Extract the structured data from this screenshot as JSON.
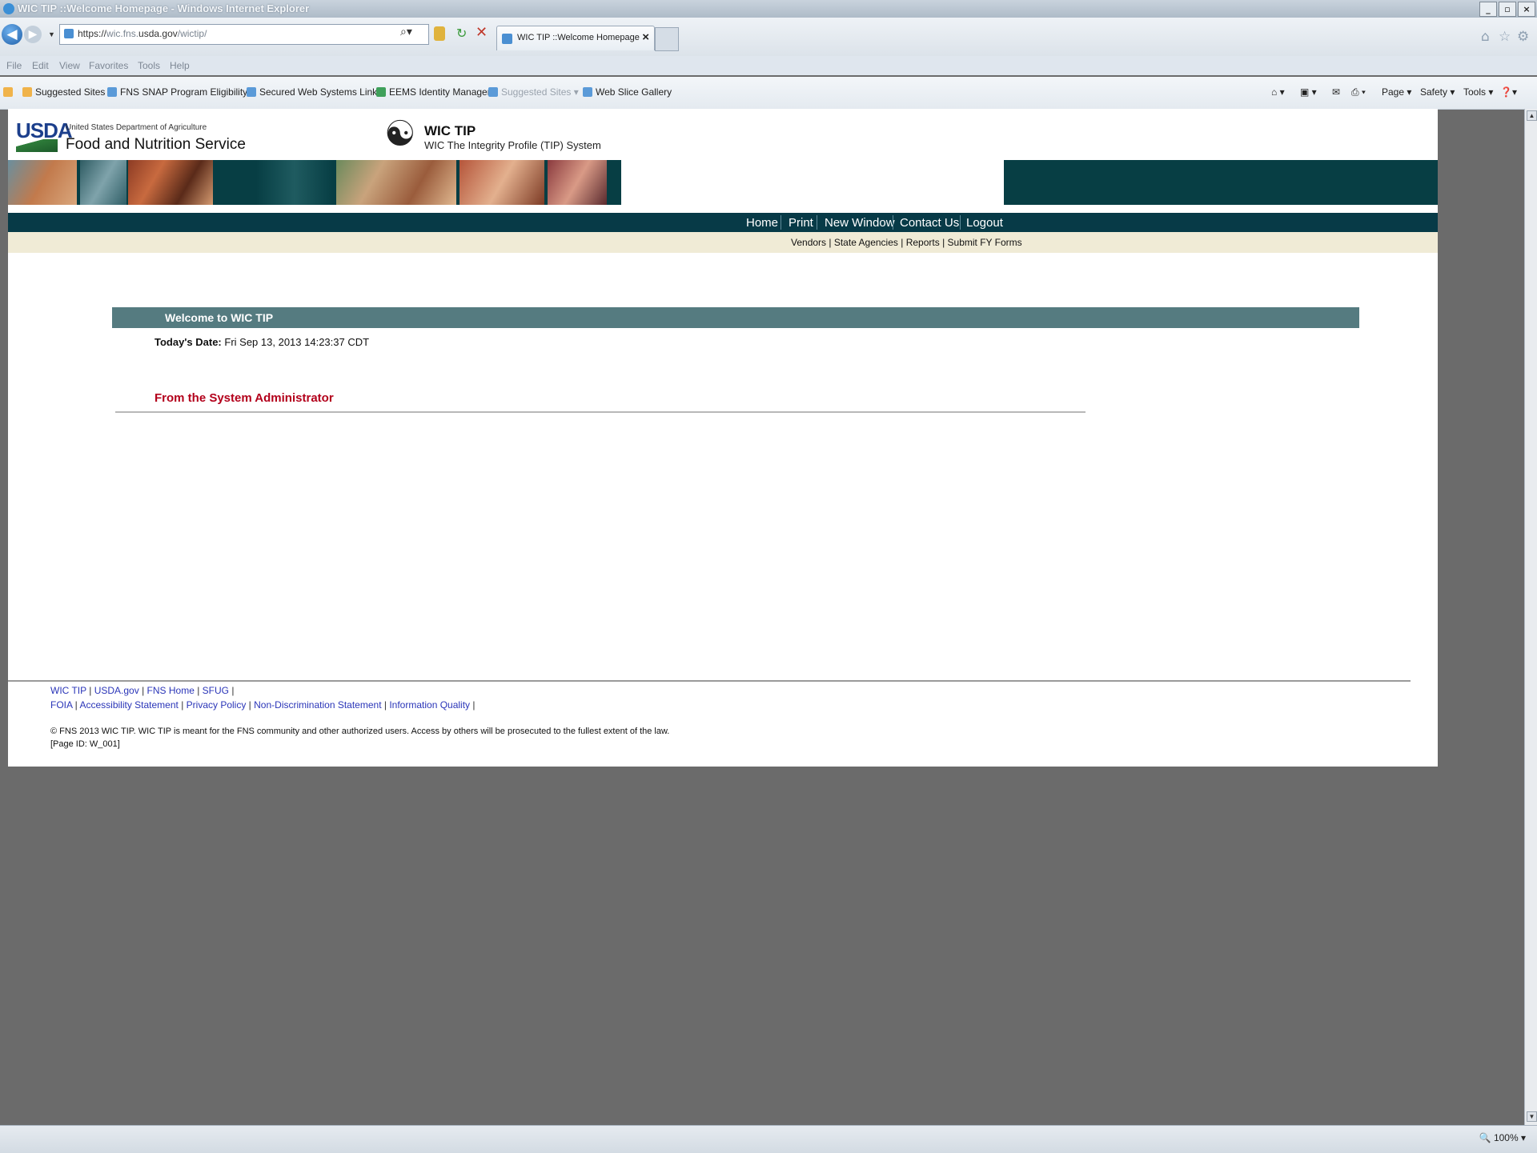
{
  "window": {
    "title": "WIC TIP ::Welcome Homepage - Windows Internet Explorer",
    "controls": [
      "_",
      "▫",
      "×"
    ]
  },
  "browser": {
    "url_prefix": "https://",
    "url_mid": "wic.fns.",
    "url_domain": "usda.gov",
    "url_path": "/wictip/",
    "tab_label": "WIC TIP ::Welcome Homepage",
    "tab_close": "×",
    "menu": [
      "File",
      "Edit",
      "View",
      "Favorites",
      "Tools",
      "Help"
    ],
    "favorites": [
      "Suggested Sites",
      "FNS SNAP Program Eligibility...",
      "Secured Web Systems Links",
      "EEMS Identity Manager",
      "Suggested Sites",
      "Web Slice Gallery"
    ],
    "commands": [
      "Page",
      "Safety",
      "Tools"
    ],
    "zoom": "100%"
  },
  "header": {
    "logo_text": "USDA",
    "agency_sub": "United States Department of Agriculture",
    "agency_name": "Food and Nutrition Service",
    "app_title": "WIC TIP",
    "app_subtitle": "WIC The Integrity Profile (TIP) System"
  },
  "topnav": [
    "Home",
    "Print",
    "New Window",
    "Contact Us",
    "Logout"
  ],
  "subnav": [
    "Vendors",
    "State Agencies",
    "Reports",
    "Submit FY Forms"
  ],
  "welcome": {
    "title": "Welcome to WIC TIP",
    "date_label": "Today's Date:",
    "date_value": "Fri Sep 13, 2013 14:23:37 CDT",
    "admin_heading": "From the System Administrator"
  },
  "footer": {
    "links1": [
      "WIC TIP",
      "USDA.gov",
      "FNS Home",
      "SFUG"
    ],
    "links2": [
      "FOIA",
      "Accessibility Statement",
      "Privacy Policy",
      "Non-Discrimination Statement",
      "Information Quality"
    ],
    "copyright": "© FNS 2013 WIC TIP.  WIC TIP is meant for the FNS community and other authorized users. Access by others will be prosecuted to the fullest extent of the law.",
    "page_id": "[Page ID: W_001]"
  },
  "colors": {
    "nav_dark": "#073a47",
    "welcome_bar": "#557b80",
    "admin_red": "#b3001b",
    "footer_link": "#2a35b8",
    "desktop_gray": "#6b6b6b"
  }
}
